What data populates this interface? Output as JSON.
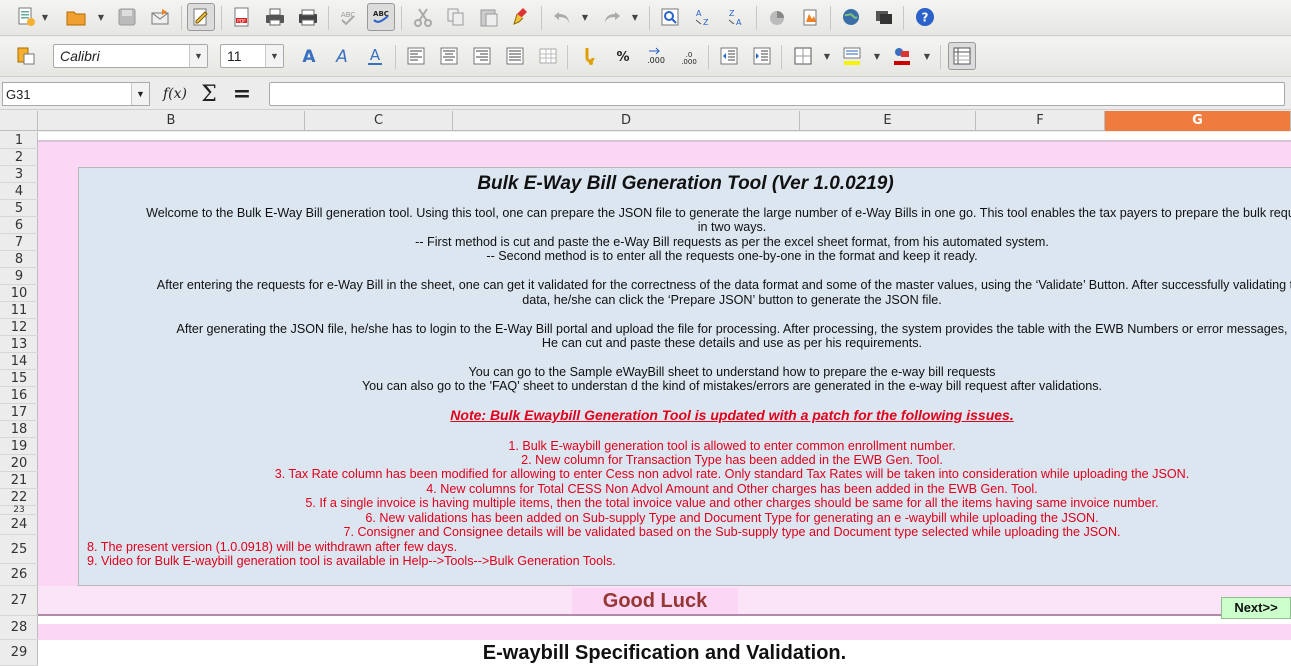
{
  "toolbar_font": {
    "font_name": "Calibri",
    "font_size": "11"
  },
  "formula_bar": {
    "cell_ref": "G31",
    "formula": "",
    "fx_symbol": "f(x)",
    "sum_symbol": "Σ",
    "equals_symbol": "="
  },
  "columns": [
    "B",
    "C",
    "D",
    "E",
    "F",
    "G"
  ],
  "rows": [
    "1",
    "2",
    "3",
    "4",
    "5",
    "6",
    "7",
    "8",
    "9",
    "10",
    "11",
    "12",
    "13",
    "14",
    "15",
    "16",
    "17",
    "18",
    "19",
    "20",
    "21",
    "22",
    "23",
    "24",
    "25",
    "26",
    "27",
    "28",
    "29"
  ],
  "sheet": {
    "title": "Bulk E-Way Bill Generation Tool (Ver 1.0.0219)",
    "intro": [
      "Welcome to the Bulk E-Way Bill generation tool. Using this tool, one can prepare the JSON file to generate the large number of e-Way Bills in one go. This tool enables the tax payers to prepare the bulk requests",
      "in two ways.",
      "-- First method is cut and paste the e-Way Bill requests as per the excel sheet format, from his automated system.",
      "-- Second method is to enter all the requests one-by-one in the format and keep it ready."
    ],
    "validate": [
      "After entering the requests for e-Way Bill in the sheet, one can get it validated for the correctness of the data format and some of the master values, using the ‘Validate’ Button. After successfully validating the",
      "data, he/she can click the ‘Prepare JSON’ button to generate the JSON file."
    ],
    "upload": [
      "After generating the JSON file, he/she has to login to the E-Way Bill portal and upload the file for processing. After processing, the system provides the table with the EWB Numbers or error messages,",
      "He can cut and paste these details and use as per his requirements."
    ],
    "sample": [
      "You can go to the Sample eWayBill sheet to understand how to prepare the e-way bill requests",
      "You can also go to the 'FAQ' sheet to understan d the kind of  mistakes/errors are generated in the e-way bill request after validations."
    ],
    "note": "Note:  Bulk Ewaybill Generation Tool  is updated with a patch for the following  issues.",
    "issues_centered": [
      "1. Bulk E-waybill generation tool is allowed to enter  common enrollment number.",
      "2. New column for Transaction Type has been added in the EWB  Gen. Tool.",
      "3. Tax Rate  column has been modified for  allowing to enter  Cess non advol rate. Only standard Tax Rates will be taken into consideration while uploading the JSON.",
      "4. New columns for Total CESS Non Advol Amount and Other charges has been added in the EWB Gen. Tool.",
      "5. If a single invoice is having multiple items,  then the total invoice value  and other charges should be same for all the items  having same invoice number.",
      "6. New validations has been added on Sub-supply Type and Document Type for generating an e -waybill  while uploading the JSON.",
      "7. Consigner  and Consignee details will be validated based on the Sub-supply type and Document type selected while uploading the JSON."
    ],
    "issues_left": [
      "8. The present version (1.0.0918) will be  withdrawn after  few days.",
      "9. Video for  Bulk E-waybill generation tool is available in  Help-->Tools-->Bulk Generation Tools."
    ],
    "good_luck": "Good Luck",
    "next_button": "Next>>",
    "spec_heading": "E-waybill  Specification and Validation."
  },
  "colors": {
    "panel_bg": "#dce6f1",
    "pink_band": "#fcd6f5",
    "red_text": "#e0001b",
    "good_luck": "#953735",
    "selected_col": "#f07b3f",
    "next_button_bg": "#ccffcc"
  },
  "icons": [
    "new-document-icon",
    "open-folder-icon",
    "save-icon",
    "email-icon",
    "edit-mode-icon",
    "export-pdf-icon",
    "print-icon",
    "print-preview-icon",
    "spellcheck-icon",
    "autospell-icon",
    "cut-icon",
    "copy-icon",
    "paste-icon",
    "clone-format-icon",
    "undo-icon",
    "redo-icon",
    "navigator-icon",
    "sort-ascending-icon",
    "sort-descending-icon",
    "chart-icon",
    "gallery-icon",
    "globe-icon",
    "toggle-view-icon",
    "help-icon"
  ]
}
